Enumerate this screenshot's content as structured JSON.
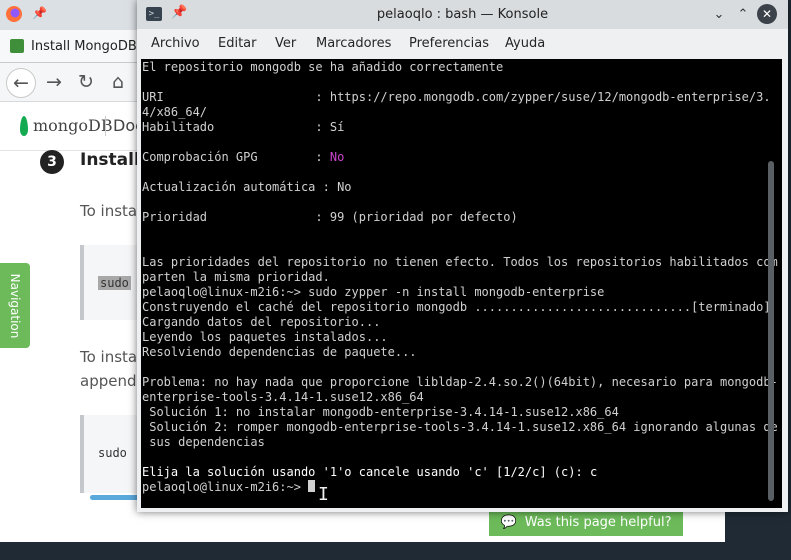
{
  "browser": {
    "tab_title": "Install MongoDB",
    "logo_text": "mongoDB",
    "docs_label": "Doc",
    "step_number": "3",
    "step_title": "Install",
    "para1": "To install",
    "code1": "sudo",
    "para2": "To install",
    "para2b": "append t",
    "code2": "sudo",
    "nav_tab": "Navigation",
    "help_button": "Was this page helpful?"
  },
  "konsole": {
    "title": "pelaoqlo : bash — Konsole",
    "menu": [
      "Archivo",
      "Editar",
      "Ver",
      "Marcadores",
      "Preferencias",
      "Ayuda"
    ],
    "lines": [
      "El repositorio mongodb se ha añadido correctamente",
      "",
      "URI                     : https://repo.mongodb.com/zypper/suse/12/mongodb-enterprise/3.",
      "4/x86_64/",
      "Habilitado              : Sí",
      "",
      "Comprobación GPG        : ",
      "",
      "Actualización automática : No",
      "",
      "Prioridad               : 99 (prioridad por defecto)",
      "",
      "",
      "Las prioridades del repositorio no tienen efecto. Todos los repositorios habilitados com",
      "parten la misma prioridad.",
      "pelaoqlo@linux-m2i6:~> sudo zypper -n install mongodb-enterprise",
      "Construyendo el caché del repositorio mongodb ..............................[terminado]",
      "Cargando datos del repositorio...",
      "Leyendo los paquetes instalados...",
      "Resolviendo dependencias de paquete...",
      "",
      "Problema: no hay nada que proporcione libldap-2.4.so.2()(64bit), necesario para mongodb-",
      "enterprise-tools-3.4.14-1.suse12.x86_64",
      " Solución 1: no instalar mongodb-enterprise-3.4.14-1.suse12.x86_64",
      " Solución 2: romper mongodb-enterprise-tools-3.4.14-1.suse12.x86_64 ignorando algunas de",
      " sus dependencias",
      "",
      "Elija la solución usando '1'o cancele usando 'c' [1/2/c] (c): ",
      "pelaoqlo@linux-m2i6:~> "
    ],
    "gpg_value": "No",
    "answer": "c",
    "colors": {
      "magenta": "#cc44cc",
      "terminal_bg": "#000000",
      "terminal_fg": "#d0d0d0"
    }
  }
}
